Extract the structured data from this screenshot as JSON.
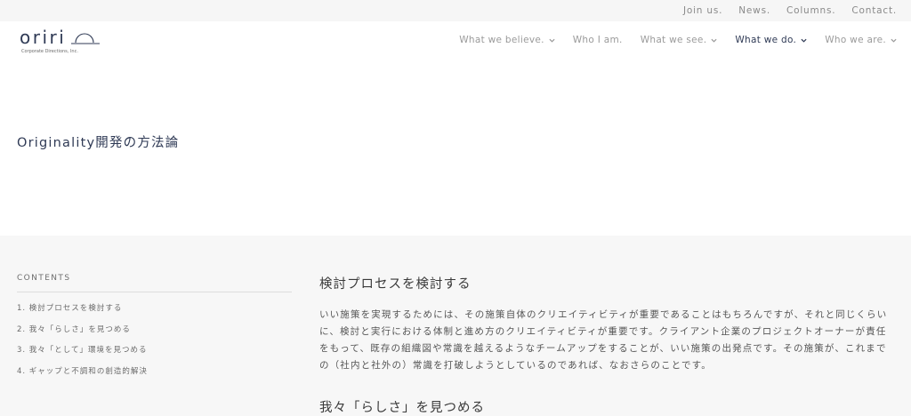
{
  "top_links": [
    "Join us.",
    "News.",
    "Columns.",
    "Contact."
  ],
  "logo": {
    "wordmark": "oriri",
    "tagline": "Corporate Directions, Inc."
  },
  "nav": [
    {
      "label": "What we believe.",
      "dropdown": true,
      "active": false
    },
    {
      "label": "Who I am.",
      "dropdown": false,
      "active": false
    },
    {
      "label": "What we see.",
      "dropdown": true,
      "active": false
    },
    {
      "label": "What we do.",
      "dropdown": true,
      "active": true
    },
    {
      "label": "Who we are.",
      "dropdown": true,
      "active": false
    }
  ],
  "page_title": "Originality開発の方法論",
  "contents": {
    "label": "CONTENTS",
    "items": [
      "1. 検討プロセスを検討する",
      "2. 我々「らしさ」を見つめる",
      "3. 我々「として」環境を見つめる",
      "4. ギャップと不調和の創造的解決"
    ]
  },
  "article": {
    "heading1": "検討プロセスを検討する",
    "paragraph1": "いい施策を実現するためには、その施策自体のクリエイティビティが重要であることはもちろんですが、それと同じくらいに、検討と実行における体制と進め方のクリエイティビティが重要です。クライアント企業のプロジェクトオーナーが責任をもって、既存の組織図や常識を越えるようなチームアップをすることが、いい施策の出発点です。その施策が、これまでの（社内と社外の）常識を打破しようとしているのであれば、なおさらのことです。",
    "heading2": "我々「らしさ」を見つめる"
  },
  "colors": {
    "brand": "#2f3a55",
    "content_bg": "#f7f7f7",
    "topbar_bg": "#f6f6f6"
  }
}
